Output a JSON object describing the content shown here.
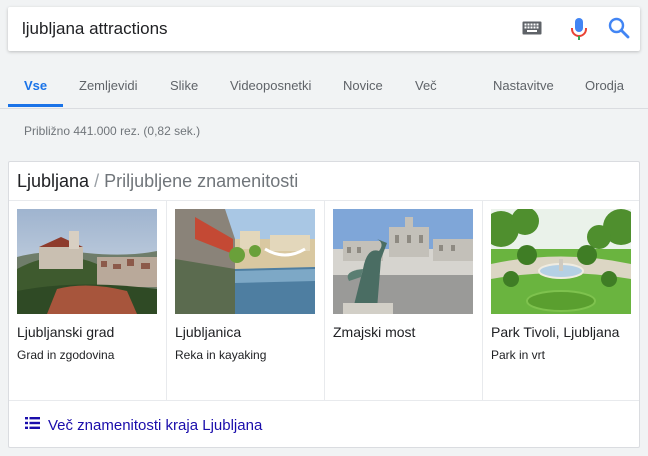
{
  "search": {
    "query": "ljubljana attractions"
  },
  "tabs": [
    {
      "label": "Vse",
      "active": true
    },
    {
      "label": "Zemljevidi"
    },
    {
      "label": "Slike"
    },
    {
      "label": "Videoposnetki"
    },
    {
      "label": "Novice"
    },
    {
      "label": "Več"
    },
    {
      "label": "Nastavitve"
    },
    {
      "label": "Orodja"
    }
  ],
  "result_stats": "Približno 441.000 rez. (0,82 sek.)",
  "card": {
    "title_main": "Ljubljana",
    "title_sep": "/",
    "title_sub": "Priljubljene znamenitosti",
    "attractions": [
      {
        "name": "Ljubljanski grad",
        "description": "Grad in zgodovina"
      },
      {
        "name": "Ljubljanica",
        "description": "Reka in kayaking"
      },
      {
        "name": "Zmajski most",
        "description": ""
      },
      {
        "name": "Park Tivoli, Ljubljana",
        "description": "Park in vrt"
      }
    ],
    "more_link": "Več znamenitosti kraja Ljubljana"
  },
  "colors": {
    "accent": "#1a73e8",
    "link": "#1a0dab",
    "mic_red": "#ea4335",
    "mic_blue": "#4285f4"
  }
}
